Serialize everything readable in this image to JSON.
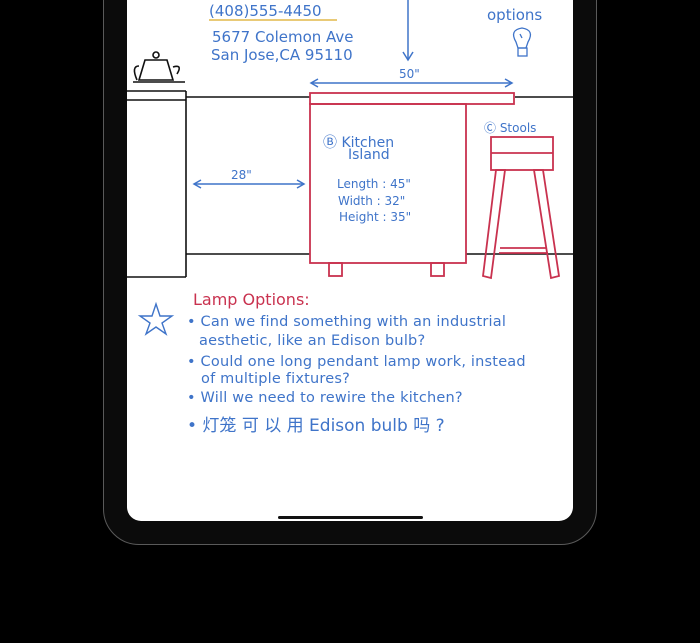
{
  "contact": {
    "phone": "(408)555-4450",
    "address_line1": "5677 Colemon Ave",
    "address_line2": "San Jose,CA 95110"
  },
  "annotations": {
    "options_label": "options",
    "top_width": "50\"",
    "aisle_width": "28\""
  },
  "kitchen_island": {
    "label_line1": "Ⓑ Kitchen",
    "label_line2": "Island",
    "length": "Length : 45\"",
    "width": "Width : 32\"",
    "height": "Height : 35\""
  },
  "stools": {
    "label": "Ⓒ Stools"
  },
  "lamp_options": {
    "title": "Lamp Options:",
    "items": [
      {
        "line1": "• Can we find something with an industrial",
        "line2": "aesthetic, like an Edison bulb?"
      },
      {
        "line1": "• Could one long pendant lamp work, instead",
        "line2": "of multiple fixtures?"
      },
      {
        "line1": "• Will we need to rewire the kitchen?",
        "line2": ""
      },
      {
        "line1": "• 灯笼 可 以 用  Edison bulb 吗 ?",
        "line2": ""
      }
    ]
  },
  "colors": {
    "ink_blue": "#3f74c9",
    "ink_red": "#c9324f",
    "ink_black": "#111111",
    "highlight_yellow": "#e2b84a"
  }
}
